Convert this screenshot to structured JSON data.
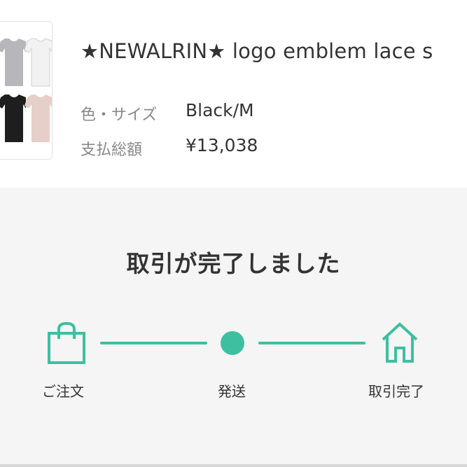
{
  "item": {
    "title": "★NEWALRIN★ logo emblem lace s",
    "color_size_label": "色・サイズ",
    "color_size_value": "Black/M",
    "total_label": "支払総額",
    "total_value": "¥13,038"
  },
  "status": {
    "message": "取引が完了しました"
  },
  "progress": {
    "steps": [
      {
        "label": "ご注文",
        "icon": "shopping-bag-icon"
      },
      {
        "label": "発送",
        "icon": "dot"
      },
      {
        "label": "取引完了",
        "icon": "home-icon"
      }
    ],
    "current_step": 3
  },
  "colors": {
    "accent": "#3ebfa0",
    "background": "#f5f5f5",
    "card": "#ffffff",
    "text": "#333333",
    "muted": "#888888"
  }
}
